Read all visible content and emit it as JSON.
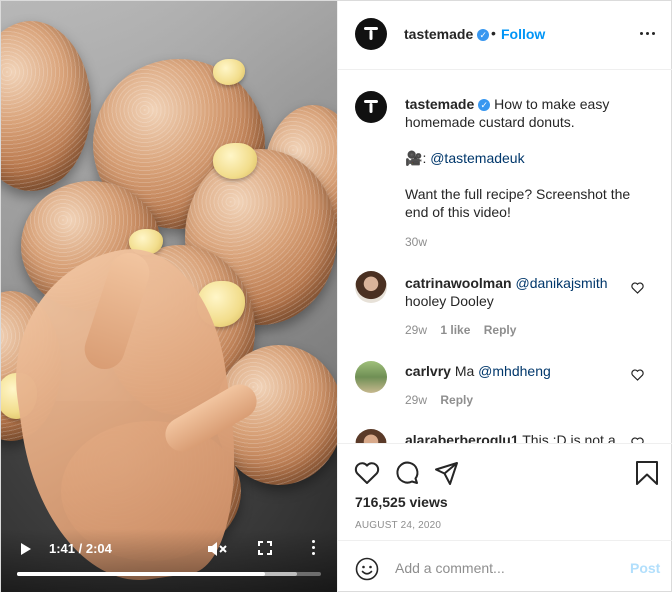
{
  "video": {
    "time_display": "1:41 / 2:04",
    "progress_fraction": 0.8145,
    "buffered_fraction": 0.92,
    "icons": [
      "play-icon",
      "mute-icon",
      "fullscreen-icon",
      "more-vertical-icon"
    ]
  },
  "header": {
    "username": "tastemade",
    "separator": "•",
    "follow_label": "Follow",
    "verified": true
  },
  "caption": {
    "username": "tastemade",
    "text": "How to make easy homemade custard donuts.",
    "emoji": "🎥",
    "mention": "@tastemadeuk",
    "cta": "Want the full recipe? Screenshot the end of this video!",
    "time": "30w"
  },
  "comments": [
    {
      "username": "catrinawoolman",
      "mention": "@danikajsmith",
      "text": "hooley Dooley",
      "time": "29w",
      "likes": "1 like",
      "reply_label": "Reply"
    },
    {
      "username": "carlvry",
      "text": "Ma",
      "mention": "@mhdheng",
      "time": "29w",
      "reply_label": "Reply"
    },
    {
      "username": "alaraberberoglu1",
      "text": "This :D is not a"
    }
  ],
  "actions": {
    "views": "716,525 views",
    "date": "AUGUST 24, 2020",
    "icons": [
      "heart-icon",
      "comment-icon",
      "share-icon",
      "bookmark-icon"
    ]
  },
  "add_comment": {
    "placeholder": "Add a comment...",
    "post_label": "Post"
  },
  "colors": {
    "accent": "#0095f6",
    "verified": "#3897f0",
    "muted": "#8e8e8e",
    "link": "#00376b",
    "post_disabled": "#b2dffc"
  }
}
